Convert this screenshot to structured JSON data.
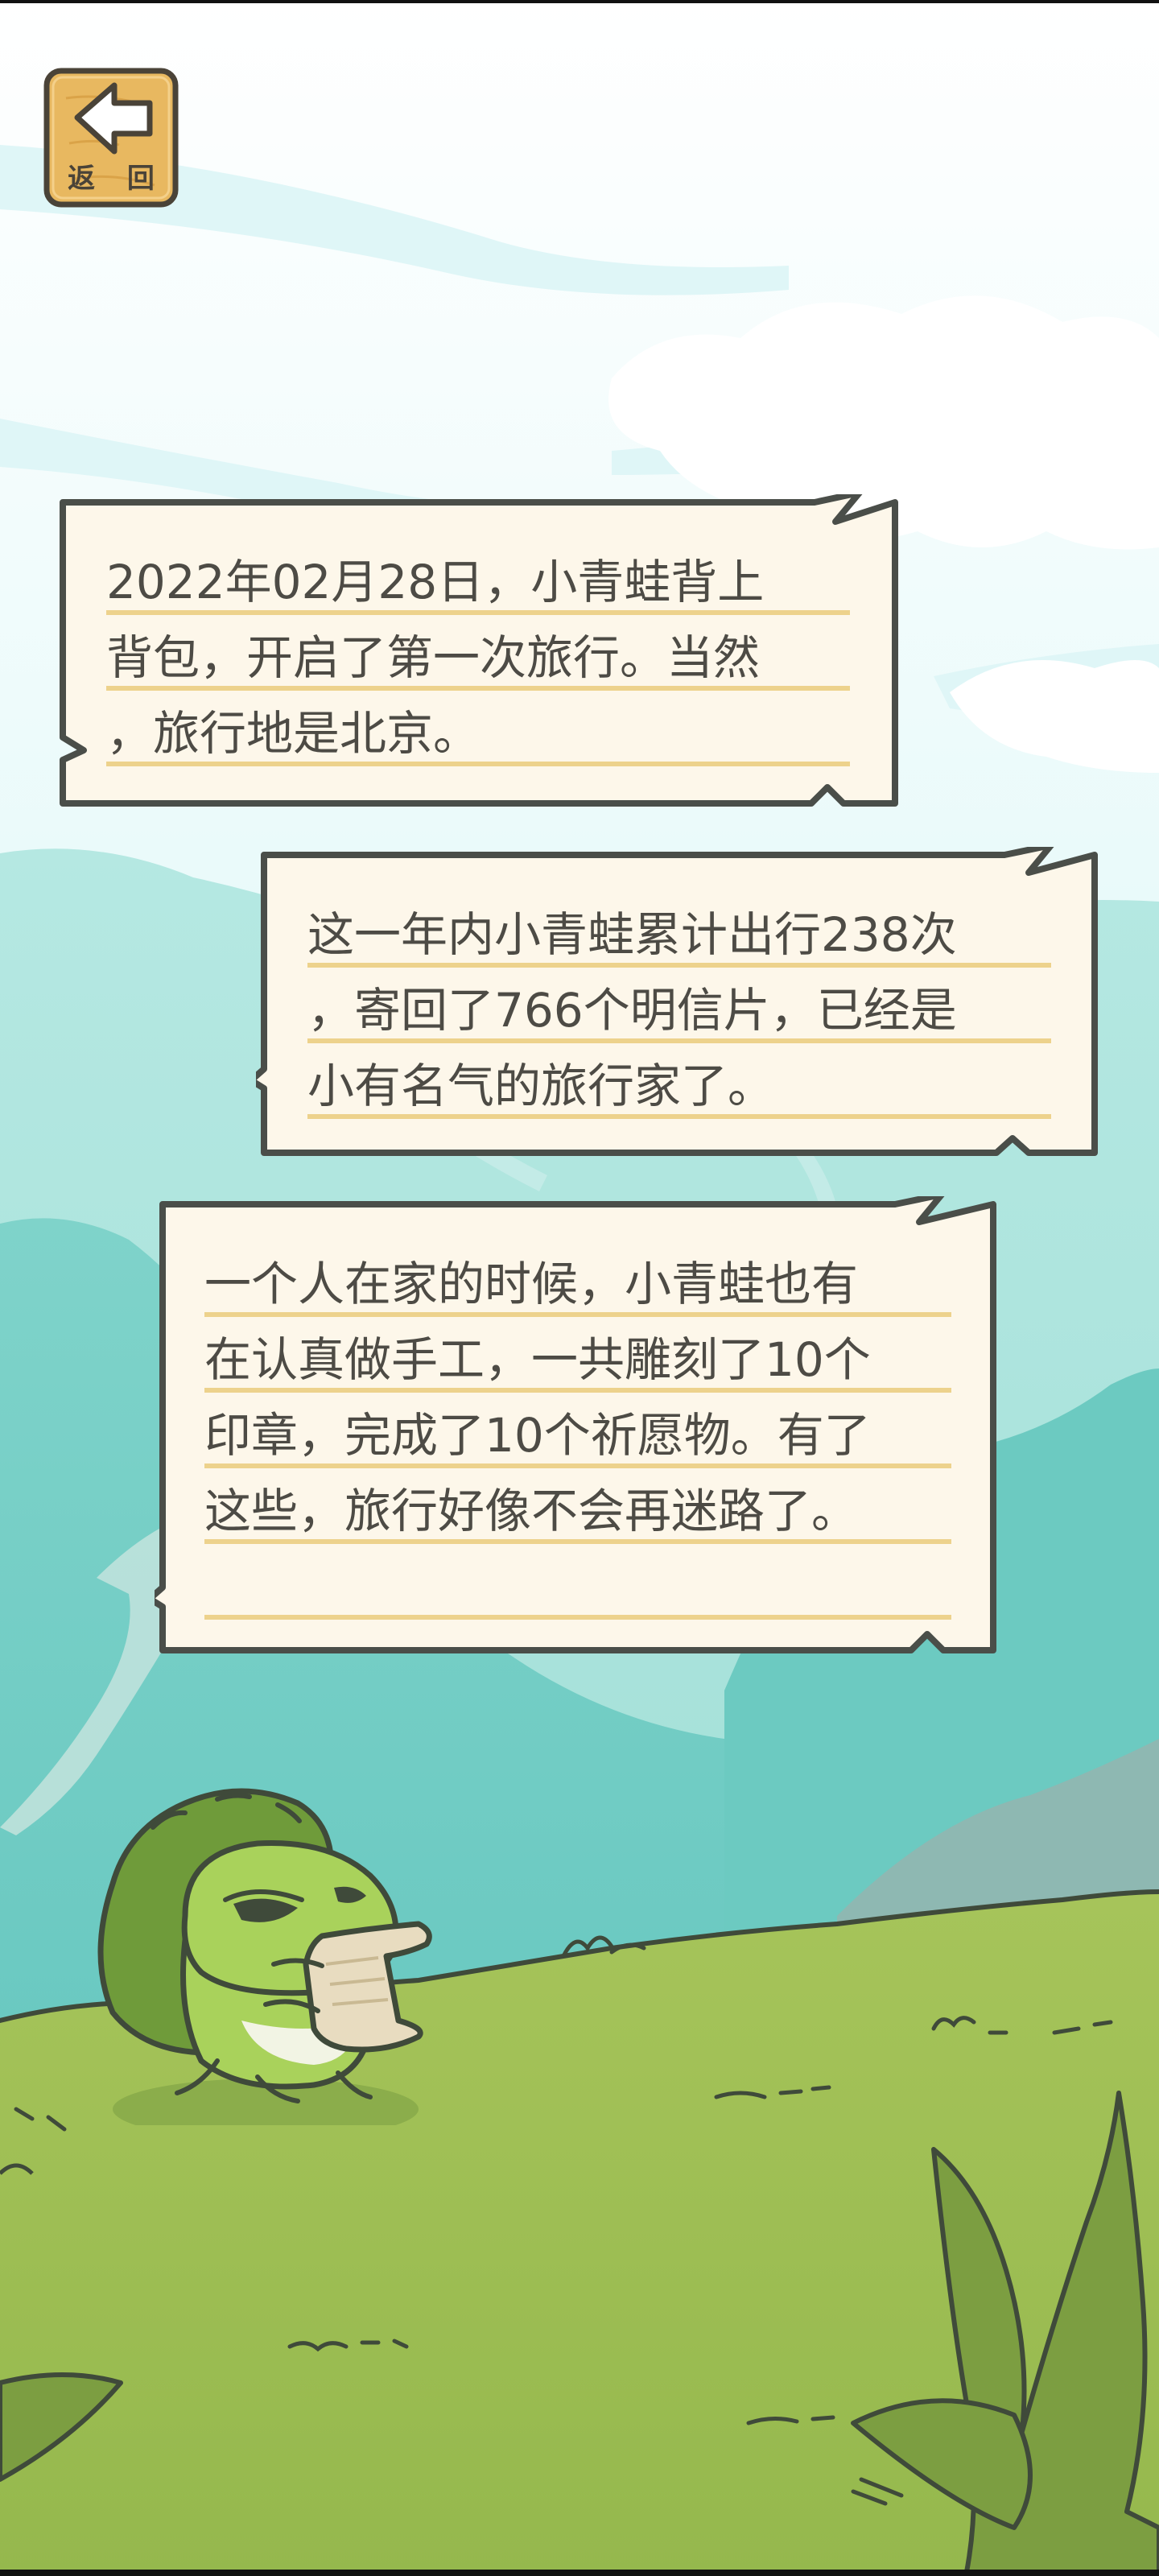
{
  "back_button": {
    "label": "返 回",
    "icon": "back-arrow-icon"
  },
  "messages": [
    {
      "lines": [
        "2022年02月28日，小青蛙背上",
        "背包，开启了第一次旅行。当然",
        "，旅行地是北京。"
      ]
    },
    {
      "lines": [
        "这一年内小青蛙累计出行238次",
        "，寄回了766个明信片，已经是",
        "小有名气的旅行家了。"
      ]
    },
    {
      "lines": [
        "一个人在家的时候，小青蛙也有",
        "在认真做手工，一共雕刻了10个",
        "印章，完成了10个祈愿物。有了",
        "这些，旅行好像不会再迷路了。",
        ""
      ]
    }
  ],
  "colors": {
    "sky_top": "#ffffff",
    "sky_mid": "#cdf2f4",
    "mountain_far": "#8fd8cf",
    "mountain_near": "#5fc3bd",
    "grass": "#9dbf52",
    "frog_green": "#8fc24a",
    "bubble_fill": "#fdf7ea",
    "bubble_border": "#4a4e49",
    "underline": "#edd28c",
    "button_wood": "#e8b860"
  }
}
